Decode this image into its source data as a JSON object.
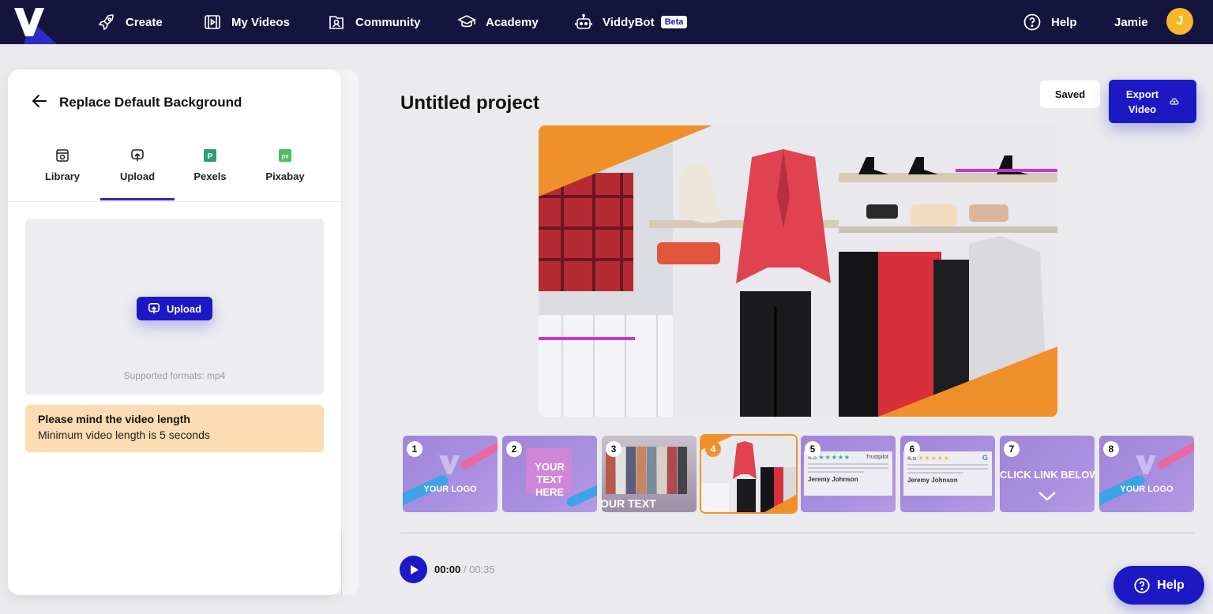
{
  "nav": {
    "items": [
      {
        "label": "Create",
        "icon": "rocket-icon"
      },
      {
        "label": "My Videos",
        "icon": "video-icon"
      },
      {
        "label": "Community",
        "icon": "community-icon"
      },
      {
        "label": "Academy",
        "icon": "graduation-cap-icon"
      },
      {
        "label": "ViddyBot",
        "icon": "robot-icon",
        "badge": "Beta"
      }
    ],
    "help_label": "Help",
    "user_name": "Jamie",
    "avatar_initial": "J"
  },
  "panel": {
    "title": "Replace Default Background",
    "tabs": [
      {
        "label": "Library",
        "icon": "library-icon"
      },
      {
        "label": "Upload",
        "icon": "upload-icon"
      },
      {
        "label": "Pexels",
        "icon": "pexels-icon"
      },
      {
        "label": "Pixabay",
        "icon": "pixabay-icon"
      }
    ],
    "active_tab": "Upload",
    "upload_label": "Upload",
    "supported_formats": "Supported formats: mp4",
    "warning_title": "Please mind the video length",
    "warning_text": "Minimum video length is 5 seconds"
  },
  "editor": {
    "project_title": "Untitled project",
    "saved_label": "Saved",
    "export_label_line1": "Export",
    "export_label_line2": "Video",
    "scenes": [
      {
        "number": "1",
        "text": "YOUR LOGO"
      },
      {
        "number": "2",
        "text": "YOUR TEXT HERE"
      },
      {
        "number": "3",
        "text": "OUR TEXT"
      },
      {
        "number": "4",
        "text": ""
      },
      {
        "number": "5",
        "text": "",
        "review_score": "4.5",
        "review_source": "Trustpilot",
        "review_name": "Jeremy Johnson"
      },
      {
        "number": "6",
        "text": "",
        "review_score": "4.5",
        "review_source": "G",
        "review_name": "Jeremy Johnson"
      },
      {
        "number": "7",
        "text": "CLICK LINK BELOW"
      },
      {
        "number": "8",
        "text": "YOUR LOGO"
      }
    ],
    "active_scene": "4",
    "current_time": "00:00",
    "total_time": "/ 00:35"
  },
  "help_fab_label": "Help",
  "colors": {
    "nav_bg": "#15143f",
    "primary": "#1c18c4",
    "accent_orange": "#f2912c",
    "warning_bg": "#fbdcb3",
    "avatar": "#f5b82a"
  }
}
